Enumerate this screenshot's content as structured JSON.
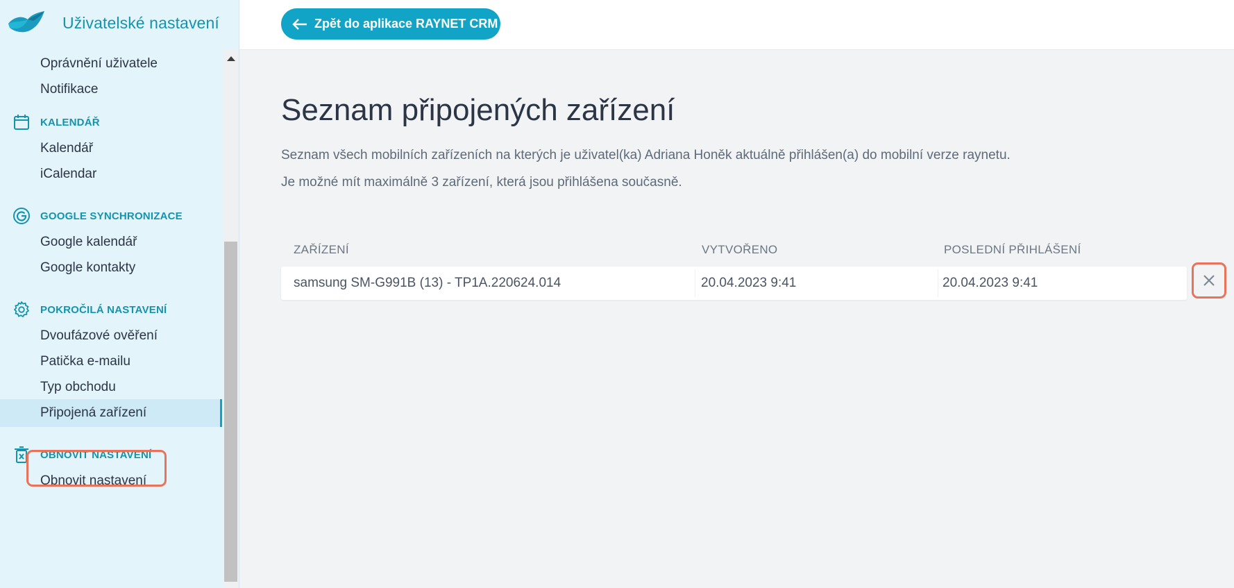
{
  "sidebar": {
    "title": "Uživatelské nastavení",
    "items_top": [
      "Oprávnění uživatele",
      "Notifikace"
    ],
    "sections": [
      {
        "title": "KALENDÁŘ",
        "icon": "calendar-icon",
        "items": [
          "Kalendář",
          "iCalendar"
        ]
      },
      {
        "title": "GOOGLE SYNCHRONIZACE",
        "icon": "google-icon",
        "items": [
          "Google kalendář",
          "Google kontakty"
        ]
      },
      {
        "title": "POKROČILÁ NASTAVENÍ",
        "icon": "gear-icon",
        "items": [
          "Dvoufázové ověření",
          "Patička e-mailu",
          "Typ obchodu",
          "Připojená zařízení"
        ]
      },
      {
        "title": "OBNOVIT NASTAVENÍ",
        "icon": "trash-icon",
        "items": [
          "Obnovit nastavení"
        ]
      }
    ],
    "active_item": "Připojená zařízení"
  },
  "topbar": {
    "back_label": "Zpět do aplikace RAYNET CRM"
  },
  "main": {
    "title": "Seznam připojených zařízení",
    "description_1": "Seznam všech mobilních zařízeních na kterých je uživatel(ka) Adriana Honěk aktuálně přihlášen(a) do mobilní verze raynetu.",
    "description_2": "Je možné mít maximálně 3 zařízení, která jsou přihlášena současně.",
    "table": {
      "columns": [
        "ZAŘÍZENÍ",
        "VYTVOŘENO",
        "POSLEDNÍ PŘIHLÁŠENÍ"
      ],
      "rows": [
        {
          "device": "samsung SM-G991B (13) - TP1A.220624.014",
          "created": "20.04.2023 9:41",
          "last_login": "20.04.2023 9:41"
        }
      ]
    }
  },
  "colors": {
    "accent": "#12a4c6",
    "sidebar_bg": "#e3f4fb",
    "highlight": "#e8735a"
  }
}
